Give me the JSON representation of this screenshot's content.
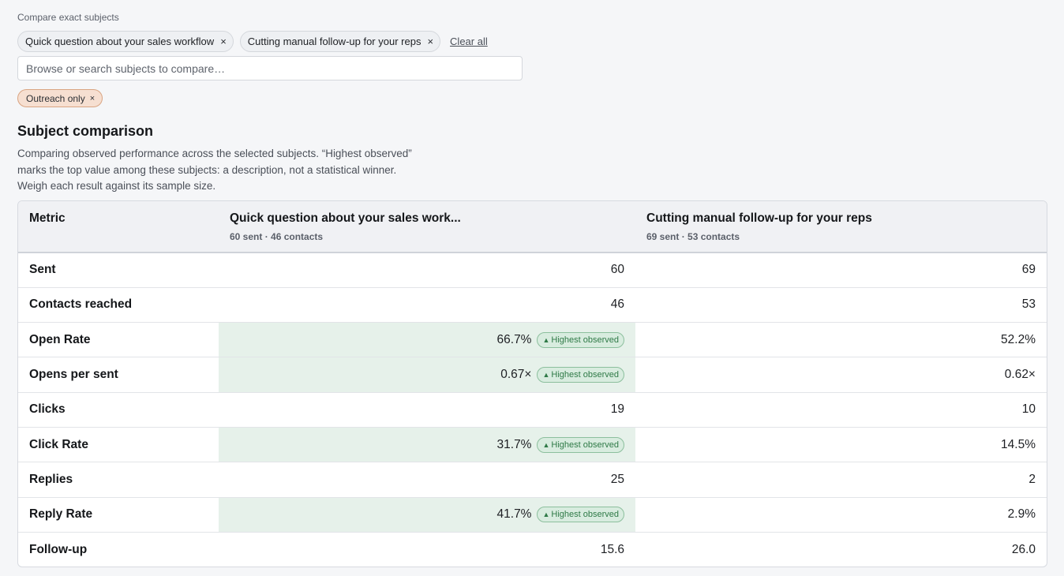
{
  "compare": {
    "label": "Compare exact subjects",
    "chips": [
      {
        "label": "Quick question about your sales workflow",
        "remove": "×"
      },
      {
        "label": "Cutting manual follow-up for your reps",
        "remove": "×"
      }
    ],
    "clear_all": "Clear all",
    "search_placeholder": "Browse or search subjects to compare…",
    "filter_chip": {
      "label": "Outreach only",
      "remove": "×"
    }
  },
  "heading": {
    "title": "Subject comparison",
    "description": "Comparing observed performance across the selected subjects. “Highest observed” marks the top value among these subjects: a description, not a statistical winner. Weigh each result against its sample size."
  },
  "table": {
    "header": {
      "metric": "Metric",
      "a_title": "Quick question about your sales work...",
      "a_sub": "60 sent · 46 contacts",
      "b_title": "Cutting manual follow-up for your reps",
      "b_sub": "69 sent · 53 contacts"
    },
    "badge_label": "Highest observed",
    "badge_icon": "triangle-up-icon",
    "highlight_color": "#e6f1ea",
    "rows": [
      {
        "metric": "Sent",
        "a": "60",
        "b": "69",
        "a_highest": false
      },
      {
        "metric": "Contacts reached",
        "a": "46",
        "b": "53",
        "a_highest": false
      },
      {
        "metric": "Open Rate",
        "a": "66.7%",
        "b": "52.2%",
        "a_highest": true
      },
      {
        "metric": "Opens per sent",
        "a": "0.67×",
        "b": "0.62×",
        "a_highest": true
      },
      {
        "metric": "Clicks",
        "a": "19",
        "b": "10",
        "a_highest": false
      },
      {
        "metric": "Click Rate",
        "a": "31.7%",
        "b": "14.5%",
        "a_highest": true
      },
      {
        "metric": "Replies",
        "a": "25",
        "b": "2",
        "a_highest": false
      },
      {
        "metric": "Reply Rate",
        "a": "41.7%",
        "b": "2.9%",
        "a_highest": true
      },
      {
        "metric": "Follow-up",
        "a": "15.6",
        "b": "26.0",
        "a_highest": false
      }
    ]
  }
}
